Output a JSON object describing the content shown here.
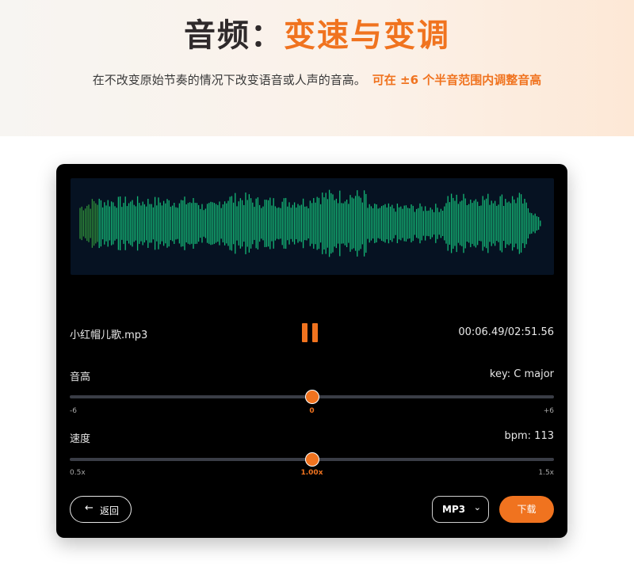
{
  "hero": {
    "title_part1": "音频：",
    "title_part2": "变速与变调",
    "subtitle": "在不改变原始节奏的情况下改变语音或人声的音高。",
    "subtitle_highlight": "可在 ±6 个半音范围内调整音高"
  },
  "player": {
    "filename": "小红帽儿歌.mp3",
    "timecode": "00:06.49/02:51.56",
    "progress_fraction": 0.038,
    "pause_icon": "pause-icon",
    "colors": {
      "accent": "#f0731f",
      "waveform": "#14b877",
      "waveform_played": "#2f8f3a",
      "card_bg": "#000000"
    }
  },
  "pitch": {
    "label": "音高",
    "value_text": "key: C major",
    "min_label": "-6",
    "max_label": "+6",
    "current_label": "0",
    "min": -6,
    "max": 6,
    "value": 0
  },
  "speed": {
    "label": "速度",
    "value_text": "bpm: 113",
    "min_label": "0.5x",
    "max_label": "1.5x",
    "current_label": "1.00x",
    "min": 0.5,
    "max": 1.5,
    "value": 1.0
  },
  "footer": {
    "back_label": "返回",
    "back_icon": "arrow-left-icon",
    "format_value": "MP3",
    "format_icon": "chevron-down-icon",
    "download_label": "下载"
  }
}
